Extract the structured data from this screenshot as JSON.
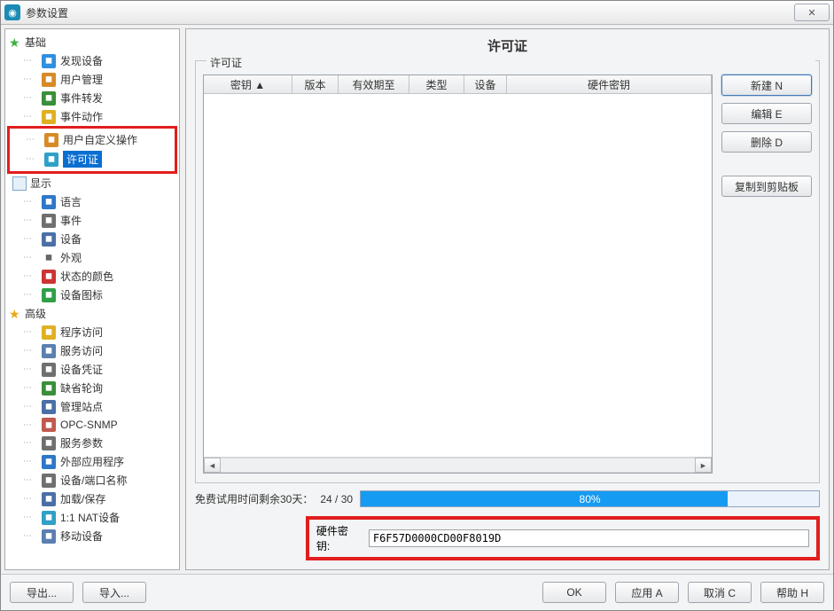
{
  "window": {
    "title": "参数设置",
    "close_symbol": "✕"
  },
  "sidebar": {
    "group_basic": "基础",
    "group_display": "显示",
    "group_advanced": "高级",
    "basic_items": [
      {
        "label": "发现设备",
        "icon_name": "magnifier-icon",
        "icon_bg": "#2f8fe0"
      },
      {
        "label": "用户管理",
        "icon_name": "user-icon",
        "icon_bg": "#d88a26"
      },
      {
        "label": "事件转发",
        "icon_name": "forward-icon",
        "icon_bg": "#3a8f3a"
      },
      {
        "label": "事件动作",
        "icon_name": "bell-icon",
        "icon_bg": "#e0b022"
      },
      {
        "label": "用户自定义操作",
        "icon_name": "user-action-icon",
        "icon_bg": "#d88a26"
      },
      {
        "label": "许可证",
        "icon_name": "license-icon",
        "icon_bg": "#2fa0c8",
        "selected": true
      }
    ],
    "display_items": [
      {
        "label": "语言",
        "icon_name": "globe-icon",
        "icon_bg": "#2f77c8"
      },
      {
        "label": "事件",
        "icon_name": "event-icon",
        "icon_bg": "#6f6f6f"
      },
      {
        "label": "设备",
        "icon_name": "device-icon",
        "icon_bg": "#4a6fa6"
      },
      {
        "label": "外观",
        "icon_name": "appearance-icon",
        "icon_bg": "#ffffff",
        "fg": "#666"
      },
      {
        "label": "状态的颜色",
        "icon_name": "colors-icon",
        "icon_bg": "#c33"
      },
      {
        "label": "设备图标",
        "icon_name": "device-icons-icon",
        "icon_bg": "#2fa048"
      }
    ],
    "advanced_items": [
      {
        "label": "程序访问",
        "icon_name": "program-access-icon",
        "icon_bg": "#e0b022"
      },
      {
        "label": "服务访问",
        "icon_name": "service-access-icon",
        "icon_bg": "#5a7fb0"
      },
      {
        "label": "设备凭证",
        "icon_name": "credentials-icon",
        "icon_bg": "#6f6f6f"
      },
      {
        "label": "缺省轮询",
        "icon_name": "poll-icon",
        "icon_bg": "#3a8f3a"
      },
      {
        "label": "管理站点",
        "icon_name": "sites-icon",
        "icon_bg": "#4a6fa6"
      },
      {
        "label": "OPC-SNMP",
        "icon_name": "opc-snmp-icon",
        "icon_bg": "#c0594e"
      },
      {
        "label": "服务参数",
        "icon_name": "service-params-icon",
        "icon_bg": "#6f6f6f"
      },
      {
        "label": "外部应用程序",
        "icon_name": "ext-app-icon",
        "icon_bg": "#2f77c8"
      },
      {
        "label": "设备/端口名称",
        "icon_name": "names-icon",
        "icon_bg": "#6f6f6f"
      },
      {
        "label": "加载/保存",
        "icon_name": "load-save-icon",
        "icon_bg": "#4a6fa6"
      },
      {
        "label": "1:1 NAT设备",
        "icon_name": "nat-icon",
        "icon_bg": "#2fa0c8"
      },
      {
        "label": "移动设备",
        "icon_name": "mobile-icon",
        "icon_bg": "#5a7fb0"
      }
    ]
  },
  "page": {
    "title": "许可证",
    "group_title": "许可证"
  },
  "table": {
    "columns": {
      "key": "密钥 ▲",
      "version": "版本",
      "expiry": "有效期至",
      "type": "类型",
      "device": "设备",
      "hwkey": "硬件密钥"
    }
  },
  "buttons": {
    "new": "新建 N",
    "edit": "编辑 E",
    "delete": "删除 D",
    "copy": "复制到剪贴板"
  },
  "trial": {
    "label_prefix": "免费试用时间剩余30天：",
    "value": "24 / 30",
    "progress_percent": 80,
    "progress_text": "80%"
  },
  "hwkey": {
    "label": "硬件密钥:",
    "value": "F6F57D0000CD00F8019D"
  },
  "footer": {
    "export": "导出...",
    "import": "导入...",
    "ok": "OK",
    "apply": "应用 A",
    "cancel": "取消 C",
    "help": "帮助 H"
  }
}
